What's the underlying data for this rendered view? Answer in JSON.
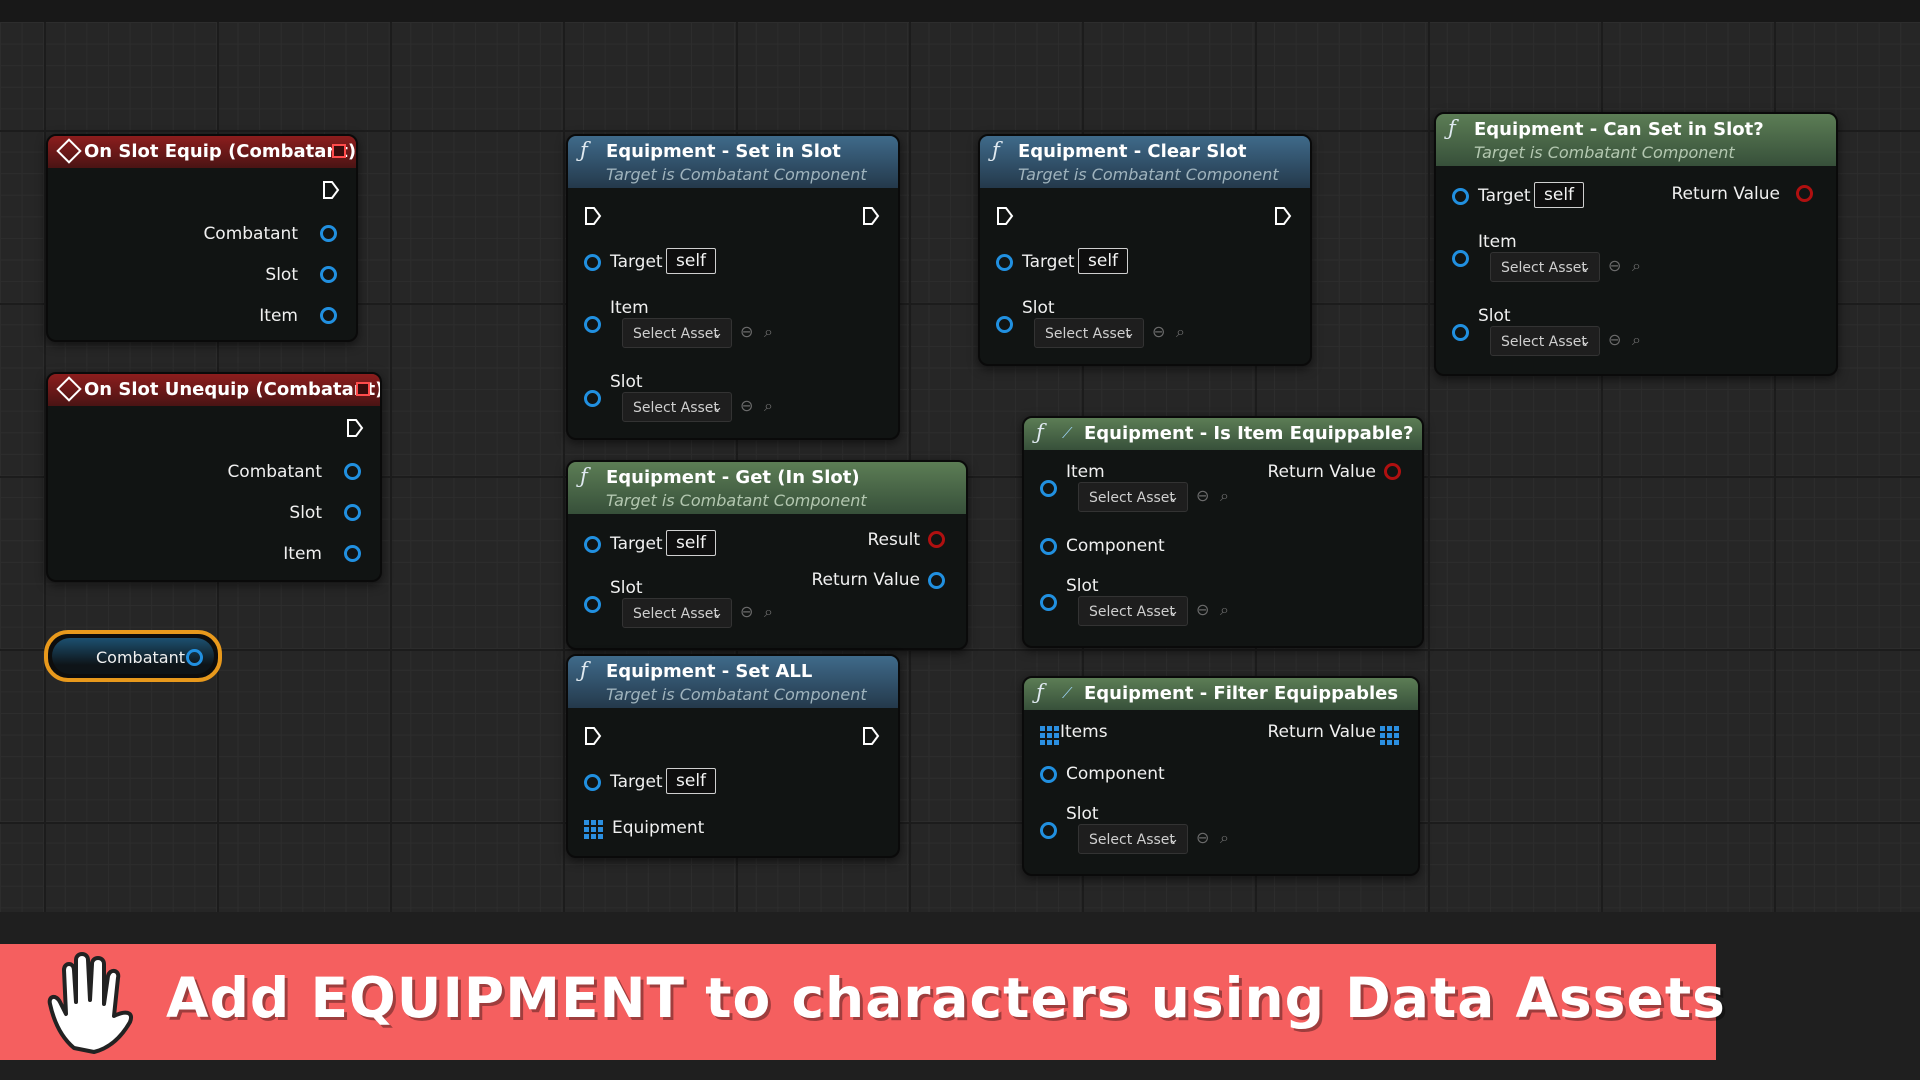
{
  "banner": {
    "text": "Add EQUIPMENT to characters using Data Assets",
    "icon": "raised-hand-icon",
    "color": "#f55f5f"
  },
  "events": [
    {
      "title": "On Slot Equip (Combatant)",
      "pins": [
        "Combatant",
        "Slot",
        "Item"
      ]
    },
    {
      "title": "On Slot Unequip (Combatant)",
      "pins": [
        "Combatant",
        "Slot",
        "Item"
      ]
    }
  ],
  "variable": {
    "label": "Combatant",
    "outline_color": "#e8991c"
  },
  "common": {
    "subtitle": "Target is Combatant Component",
    "target": "Target",
    "self": "self",
    "select_asset": "Select Asset",
    "item": "Item",
    "slot": "Slot",
    "return_value": "Return Value",
    "component": "Component"
  },
  "nodes": {
    "set_in_slot": {
      "title": "Equipment - Set in Slot"
    },
    "clear_slot": {
      "title": "Equipment - Clear Slot"
    },
    "can_set": {
      "title": "Equipment - Can Set in Slot?"
    },
    "get_in_slot": {
      "title": "Equipment - Get (In Slot)",
      "result": "Result"
    },
    "set_all": {
      "title": "Equipment - Set ALL",
      "equipment": "Equipment"
    },
    "is_equippable": {
      "title": "Equipment - Is Item Equippable?"
    },
    "filter": {
      "title": "Equipment - Filter Equippables",
      "items": "Items"
    }
  },
  "colors": {
    "object_pin": "#2190e0",
    "bool_pin": "#b01010",
    "function_header": "#3f6a8a",
    "pure_header": "#5c7d55",
    "event_header": "#8c1d1d"
  }
}
